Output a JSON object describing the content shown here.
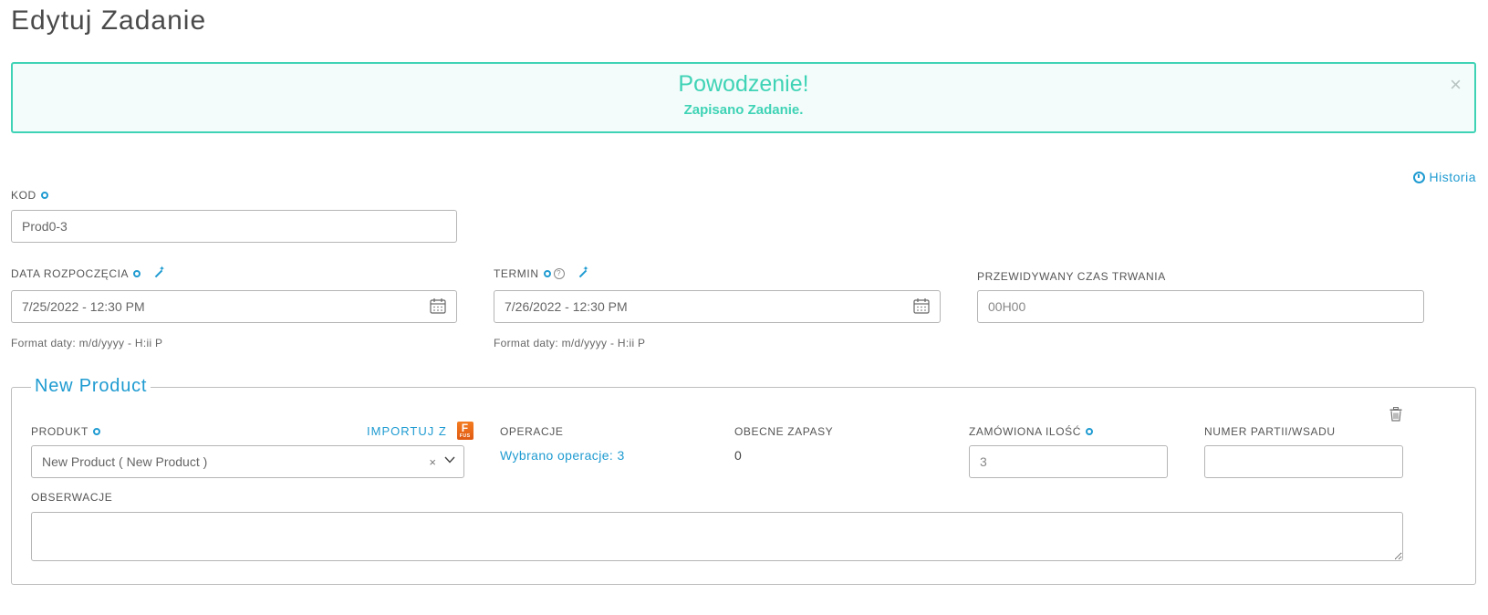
{
  "page": {
    "title": "Edytuj Zadanie"
  },
  "alert": {
    "title": "Powodzenie!",
    "message": "Zapisano Zadanie.",
    "close": "×"
  },
  "header": {
    "history_label": "Historia"
  },
  "form": {
    "code": {
      "label": "KOD",
      "value": "Prod0-3"
    },
    "start_date": {
      "label": "DATA ROZPOCZĘCIA",
      "value": "7/25/2022 - 12:30 PM",
      "hint": "Format daty: m/d/yyyy - H:ii P"
    },
    "deadline": {
      "label": "TERMIN",
      "value": "7/26/2022 - 12:30 PM",
      "hint": "Format daty: m/d/yyyy - H:ii P",
      "help": "?"
    },
    "duration": {
      "label": "PRZEWIDYWANY CZAS TRWANIA",
      "placeholder": "00H00"
    }
  },
  "product_section": {
    "legend": "New Product",
    "product": {
      "label": "PRODUKT",
      "import_label": "IMPORTUJ Z",
      "fusion_letter": "F",
      "fusion_sub": "FUS",
      "selected": "New Product ( New Product )",
      "clear": "×"
    },
    "operations": {
      "label": "OPERACJE",
      "value": "Wybrano operacje: 3"
    },
    "stock": {
      "label": "OBECNE ZAPASY",
      "value": "0"
    },
    "ordered_qty": {
      "label": "ZAMÓWIONA ILOŚĆ",
      "value": "3"
    },
    "batch": {
      "label": "NUMER PARTII/WSADU",
      "value": ""
    },
    "notes": {
      "label": "OBSERWACJE",
      "value": ""
    }
  },
  "colors": {
    "accent": "#1f9bd1",
    "success": "#3fd3b6",
    "border": "#b5b5b5"
  }
}
